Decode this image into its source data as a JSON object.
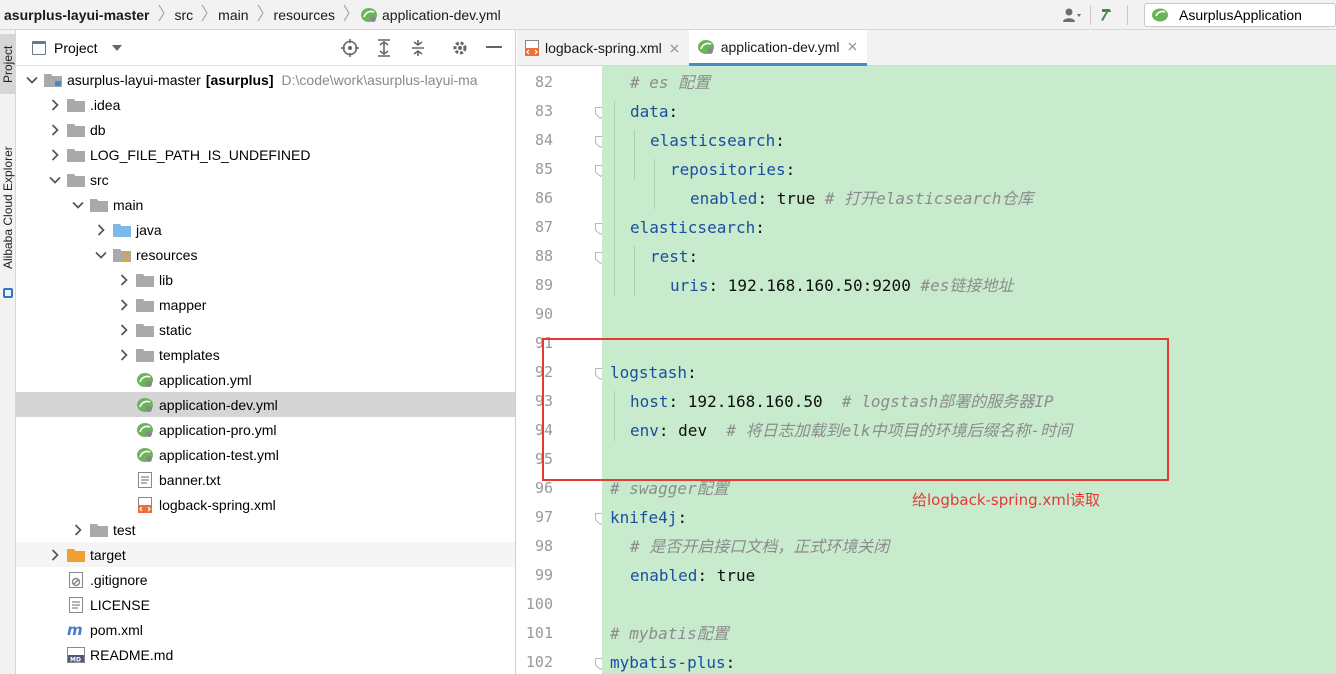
{
  "breadcrumbs": [
    {
      "label": "asurplus-layui-master",
      "bold": true
    },
    {
      "label": "src"
    },
    {
      "label": "main"
    },
    {
      "label": "resources"
    },
    {
      "label": "application-dev.yml",
      "icon": "spring-yml-icon"
    }
  ],
  "run_config": {
    "label": "AsurplusApplication"
  },
  "left_strip": {
    "project_tab": "Project",
    "explorer_tab": "Alibaba Cloud Explorer"
  },
  "project_panel": {
    "title": "Project"
  },
  "tree": [
    {
      "label": "asurplus-layui-master",
      "module": "[asurplus]",
      "path": "D:\\code\\work\\asurplus-layui-ma",
      "depth": 0,
      "expand": "open",
      "icon": "module-folder-icon"
    },
    {
      "label": ".idea",
      "depth": 1,
      "expand": "closed",
      "icon": "folder-icon"
    },
    {
      "label": "db",
      "depth": 1,
      "expand": "closed",
      "icon": "folder-icon"
    },
    {
      "label": "LOG_FILE_PATH_IS_UNDEFINED",
      "depth": 1,
      "expand": "closed",
      "icon": "folder-icon"
    },
    {
      "label": "src",
      "depth": 1,
      "expand": "open",
      "icon": "folder-icon"
    },
    {
      "label": "main",
      "depth": 2,
      "expand": "open",
      "icon": "folder-icon"
    },
    {
      "label": "java",
      "depth": 3,
      "expand": "closed",
      "icon": "source-folder-icon"
    },
    {
      "label": "resources",
      "depth": 3,
      "expand": "open",
      "icon": "resources-folder-icon"
    },
    {
      "label": "lib",
      "depth": 4,
      "expand": "closed",
      "icon": "folder-icon"
    },
    {
      "label": "mapper",
      "depth": 4,
      "expand": "closed",
      "icon": "folder-icon"
    },
    {
      "label": "static",
      "depth": 4,
      "expand": "closed",
      "icon": "folder-icon"
    },
    {
      "label": "templates",
      "depth": 4,
      "expand": "closed",
      "icon": "folder-icon"
    },
    {
      "label": "application.yml",
      "depth": 4,
      "expand": "none",
      "icon": "spring-yml-icon"
    },
    {
      "label": "application-dev.yml",
      "depth": 4,
      "expand": "none",
      "icon": "spring-yml-icon",
      "selected": true
    },
    {
      "label": "application-pro.yml",
      "depth": 4,
      "expand": "none",
      "icon": "spring-yml-icon"
    },
    {
      "label": "application-test.yml",
      "depth": 4,
      "expand": "none",
      "icon": "spring-yml-icon"
    },
    {
      "label": "banner.txt",
      "depth": 4,
      "expand": "none",
      "icon": "text-file-icon"
    },
    {
      "label": "logback-spring.xml",
      "depth": 4,
      "expand": "none",
      "icon": "xml-file-icon"
    },
    {
      "label": "test",
      "depth": 2,
      "expand": "closed",
      "icon": "folder-icon"
    },
    {
      "label": "target",
      "depth": 1,
      "expand": "closed",
      "icon": "excluded-folder-icon",
      "highlight": true
    },
    {
      "label": ".gitignore",
      "depth": 1,
      "expand": "none",
      "icon": "gitignore-file-icon"
    },
    {
      "label": "LICENSE",
      "depth": 1,
      "expand": "none",
      "icon": "text-file-icon"
    },
    {
      "label": "pom.xml",
      "depth": 1,
      "expand": "none",
      "icon": "maven-file-icon"
    },
    {
      "label": "README.md",
      "depth": 1,
      "expand": "none",
      "icon": "markdown-file-icon"
    }
  ],
  "editor_tabs": [
    {
      "label": "logback-spring.xml",
      "icon": "xml-file-icon",
      "active": false
    },
    {
      "label": "application-dev.yml",
      "icon": "spring-yml-icon",
      "active": true
    }
  ],
  "code_lines": [
    {
      "n": "82",
      "indent": 1,
      "comment": "# es 配置"
    },
    {
      "n": "83",
      "indent": 1,
      "key": "data",
      "sep": ":"
    },
    {
      "n": "84",
      "indent": 2,
      "key": "elasticsearch",
      "sep": ":"
    },
    {
      "n": "85",
      "indent": 3,
      "key": "repositories",
      "sep": ":"
    },
    {
      "n": "86",
      "indent": 4,
      "key": "enabled",
      "sep": ": ",
      "value": "true",
      "comment": " # 打开elasticsearch仓库"
    },
    {
      "n": "87",
      "indent": 1,
      "key": "elasticsearch",
      "sep": ":"
    },
    {
      "n": "88",
      "indent": 2,
      "key": "rest",
      "sep": ":"
    },
    {
      "n": "89",
      "indent": 3,
      "key": "uris",
      "sep": ": ",
      "value": "192.168.160.50:9200",
      "comment": " #es链接地址"
    },
    {
      "n": "90",
      "indent": 0
    },
    {
      "n": "91",
      "indent": 0
    },
    {
      "n": "92",
      "indent": 0,
      "key": "logstash",
      "sep": ":"
    },
    {
      "n": "93",
      "indent": 1,
      "key": "host",
      "sep": ": ",
      "value": "192.168.160.50",
      "comment": "  # logstash部署的服务器IP"
    },
    {
      "n": "94",
      "indent": 1,
      "key": "env",
      "sep": ": ",
      "value": "dev",
      "comment": "  # 将日志加载到elk中项目的环境后缀名称-时间"
    },
    {
      "n": "95",
      "indent": 0
    },
    {
      "n": "96",
      "indent": 0,
      "comment": "# swagger配置"
    },
    {
      "n": "97",
      "indent": 0,
      "key": "knife4j",
      "sep": ":"
    },
    {
      "n": "98",
      "indent": 1,
      "comment": "# 是否开启接口文档，正式环境关闭"
    },
    {
      "n": "99",
      "indent": 1,
      "key": "enabled",
      "sep": ": ",
      "value": "true"
    },
    {
      "n": "100",
      "indent": 0
    },
    {
      "n": "101",
      "indent": 0,
      "comment": "# mybatis配置"
    },
    {
      "n": "102",
      "indent": 0,
      "key": "mybatis-plus",
      "sep": ":"
    }
  ],
  "annotation": {
    "text": "给logback-spring.xml读取",
    "color": "#e53935"
  },
  "colors": {
    "editor_background": "#c7ebcc",
    "yaml_key": "#1a4fa0",
    "comment": "#8c8c8c",
    "selection": "#d5d5d5",
    "active_tab_underline": "#4a88c7",
    "annotation_box": "#e53935"
  }
}
